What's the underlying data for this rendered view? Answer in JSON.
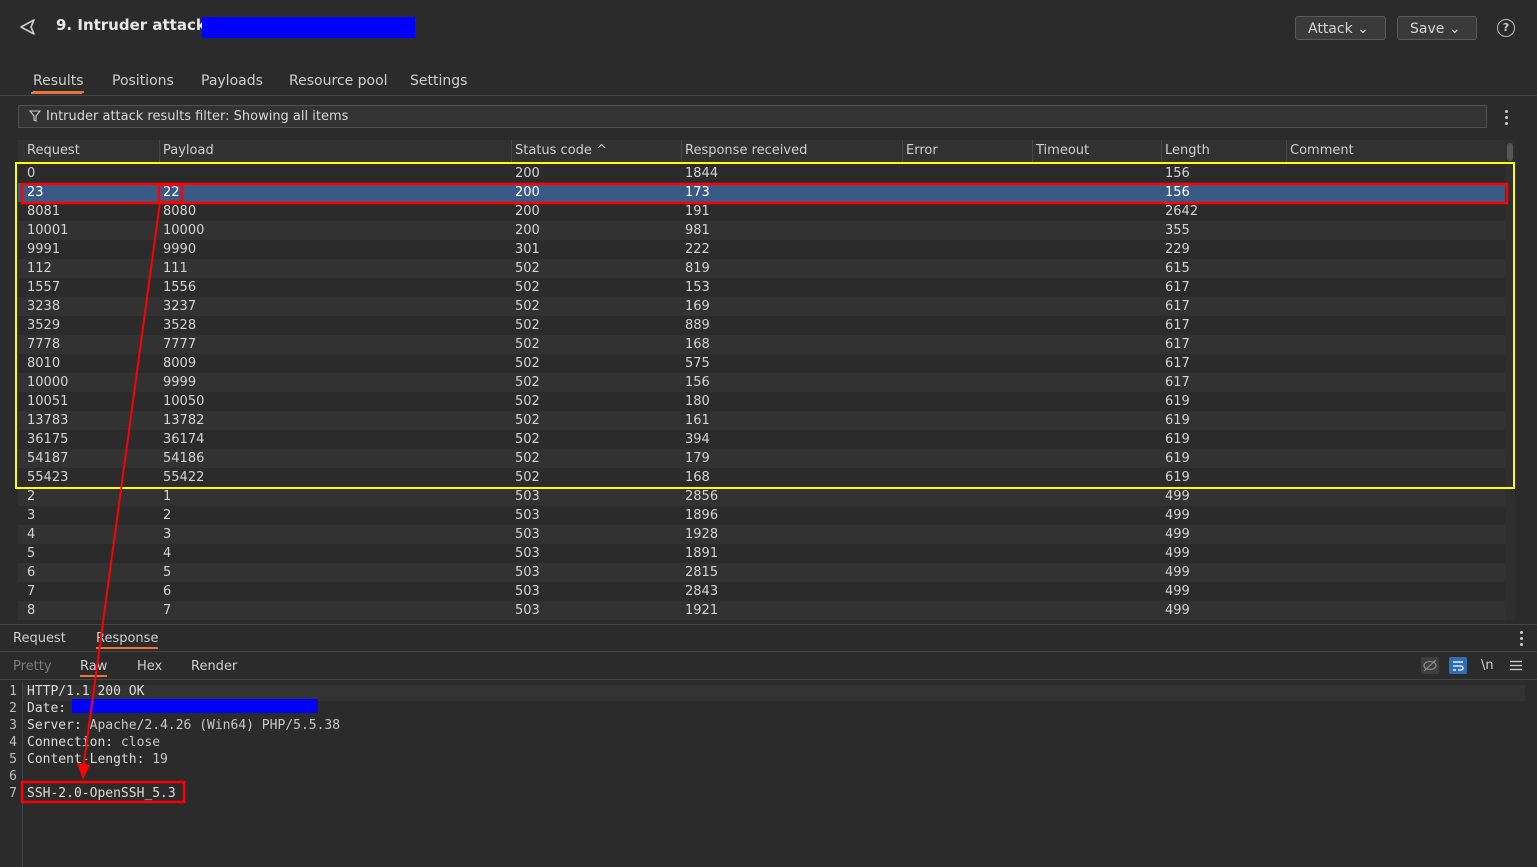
{
  "title": "9. Intruder attack of",
  "header_buttons": {
    "attack": "Attack",
    "save": "Save",
    "help": "?"
  },
  "tabs": [
    "Results",
    "Positions",
    "Payloads",
    "Resource pool",
    "Settings"
  ],
  "filter_text": "Intruder attack results filter: Showing all items",
  "columns": [
    "Request",
    "Payload",
    "Status code",
    "Response received",
    "Error",
    "Timeout",
    "Length",
    "Comment"
  ],
  "sort_indicator": "^",
  "rows": [
    [
      "0",
      "",
      "200",
      "1844",
      "",
      "",
      "156",
      ""
    ],
    [
      "23",
      "22",
      "200",
      "173",
      "",
      "",
      "156",
      ""
    ],
    [
      "8081",
      "8080",
      "200",
      "191",
      "",
      "",
      "2642",
      ""
    ],
    [
      "10001",
      "10000",
      "200",
      "981",
      "",
      "",
      "355",
      ""
    ],
    [
      "9991",
      "9990",
      "301",
      "222",
      "",
      "",
      "229",
      ""
    ],
    [
      "112",
      "111",
      "502",
      "819",
      "",
      "",
      "615",
      ""
    ],
    [
      "1557",
      "1556",
      "502",
      "153",
      "",
      "",
      "617",
      ""
    ],
    [
      "3238",
      "3237",
      "502",
      "169",
      "",
      "",
      "617",
      ""
    ],
    [
      "3529",
      "3528",
      "502",
      "889",
      "",
      "",
      "617",
      ""
    ],
    [
      "7778",
      "7777",
      "502",
      "168",
      "",
      "",
      "617",
      ""
    ],
    [
      "8010",
      "8009",
      "502",
      "575",
      "",
      "",
      "617",
      ""
    ],
    [
      "10000",
      "9999",
      "502",
      "156",
      "",
      "",
      "617",
      ""
    ],
    [
      "10051",
      "10050",
      "502",
      "180",
      "",
      "",
      "619",
      ""
    ],
    [
      "13783",
      "13782",
      "502",
      "161",
      "",
      "",
      "619",
      ""
    ],
    [
      "36175",
      "36174",
      "502",
      "394",
      "",
      "",
      "619",
      ""
    ],
    [
      "54187",
      "54186",
      "502",
      "179",
      "",
      "",
      "619",
      ""
    ],
    [
      "55423",
      "55422",
      "502",
      "168",
      "",
      "",
      "619",
      ""
    ],
    [
      "2",
      "1",
      "503",
      "2856",
      "",
      "",
      "499",
      ""
    ],
    [
      "3",
      "2",
      "503",
      "1896",
      "",
      "",
      "499",
      ""
    ],
    [
      "4",
      "3",
      "503",
      "1928",
      "",
      "",
      "499",
      ""
    ],
    [
      "5",
      "4",
      "503",
      "1891",
      "",
      "",
      "499",
      ""
    ],
    [
      "6",
      "5",
      "503",
      "2815",
      "",
      "",
      "499",
      ""
    ],
    [
      "7",
      "6",
      "503",
      "2843",
      "",
      "",
      "499",
      ""
    ],
    [
      "8",
      "7",
      "503",
      "1921",
      "",
      "",
      "499",
      ""
    ]
  ],
  "selected_row": 1,
  "message_tabs": [
    "Request",
    "Response"
  ],
  "view_tabs": [
    "Pretty",
    "Raw",
    "Hex",
    "Render"
  ],
  "editor_tools": {
    "newline": "\\n"
  },
  "response_lines": [
    [
      "HTTP/1.1 200 OK",
      ""
    ],
    [
      "Date:",
      ""
    ],
    [
      "Server:",
      " Apache/2.4.26 (Win64) PHP/5.5.38"
    ],
    [
      "Connection:",
      " close"
    ],
    [
      "Content-Length:",
      " 19"
    ],
    [
      "",
      ""
    ],
    [
      "SSH-2.0-OpenSSH_5.3",
      ""
    ]
  ],
  "colors": {
    "accent": "#e8763a",
    "selection": "#3a5a86",
    "annotation_box": "#ffff00",
    "annotation_red": "#ff0000",
    "redaction": "#0000ff"
  }
}
